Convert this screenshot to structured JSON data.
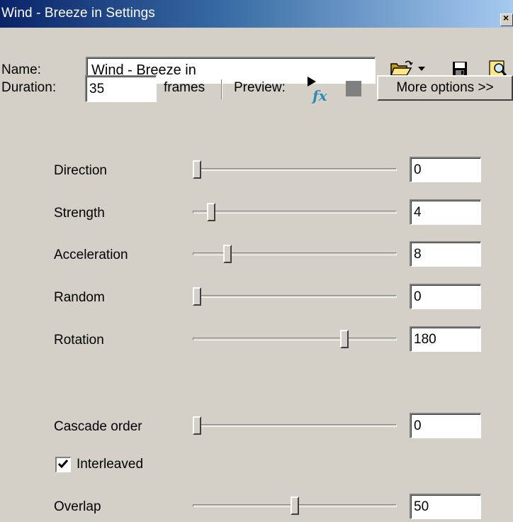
{
  "window": {
    "title": "Wind - Breeze in Settings",
    "close_glyph": "×"
  },
  "toolbar": {
    "name_label": "Name:",
    "name_value": "Wind - Breeze in",
    "duration_label": "Duration:",
    "duration_value": "35",
    "frames_label": "frames",
    "preview_label": "Preview:",
    "more_options_label": "More options >>",
    "icons": [
      "open-folder-icon",
      "dropdown-arrow-icon",
      "save-disk-icon",
      "browse-magnifier-icon",
      "preview-fx-icon",
      "stop-icon"
    ]
  },
  "params": [
    {
      "label": "Direction",
      "value": "0",
      "slider_fraction": 0.0
    },
    {
      "label": "Strength",
      "value": "4",
      "slider_fraction": 0.09
    },
    {
      "label": "Acceleration",
      "value": "8",
      "slider_fraction": 0.17
    },
    {
      "label": "Random",
      "value": "0",
      "slider_fraction": 0.0
    },
    {
      "label": "Rotation",
      "value": "180",
      "slider_fraction": 0.74
    }
  ],
  "cascade": {
    "label": "Cascade order",
    "value": "0",
    "slider_fraction": 0.0
  },
  "interleaved": {
    "label": "Interleaved",
    "checked": true
  },
  "overlap": {
    "label": "Overlap",
    "value": "50",
    "slider_fraction": 0.5
  }
}
